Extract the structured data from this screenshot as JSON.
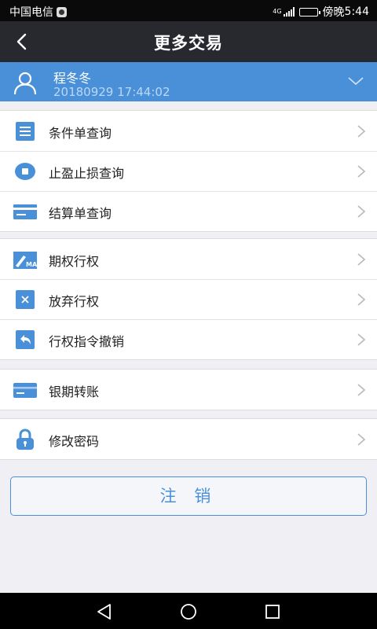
{
  "status_bar": {
    "carrier": "中国电信",
    "network": "4G",
    "time_prefix": "傍晚",
    "time": "5:44",
    "battery_level": 0.85
  },
  "header": {
    "title": "更多交易",
    "back_icon": "chevron-left-icon"
  },
  "account": {
    "name": "程冬冬",
    "login_time": "20180929 17:44:02",
    "avatar_icon": "user-icon",
    "expand_icon": "chevron-down-icon"
  },
  "menu_groups": [
    {
      "items": [
        {
          "label": "条件单查询",
          "icon": "list-document-icon"
        },
        {
          "label": "止盈止损查询",
          "icon": "stop-circle-icon"
        },
        {
          "label": "结算单查询",
          "icon": "card-icon"
        }
      ]
    },
    {
      "items": [
        {
          "label": "期权行权",
          "icon": "pen-ma-icon"
        },
        {
          "label": "放弃行权",
          "icon": "x-box-icon"
        },
        {
          "label": "行权指令撤销",
          "icon": "undo-icon"
        }
      ]
    },
    {
      "items": [
        {
          "label": "银期转账",
          "icon": "bank-card-icon"
        }
      ]
    },
    {
      "items": [
        {
          "label": "修改密码",
          "icon": "lock-icon"
        }
      ]
    }
  ],
  "logout_label": "注 销",
  "nav_bar": {
    "back": "triangle-back-icon",
    "home": "circle-home-icon",
    "recent": "square-recent-icon"
  },
  "colors": {
    "accent": "#4a90d9",
    "header_bg": "#27292e",
    "page_bg": "#efeff4"
  }
}
